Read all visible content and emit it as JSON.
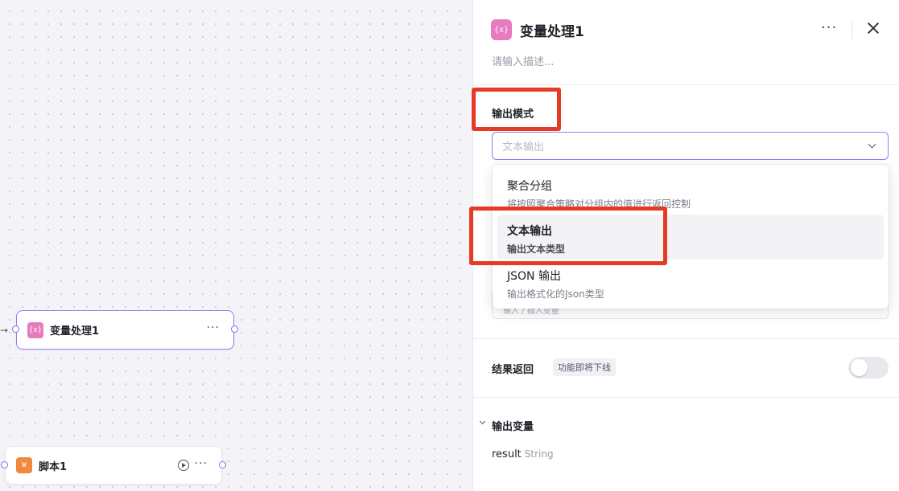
{
  "canvas": {
    "variable_node": {
      "icon_text": "{x}",
      "title": "变量处理1",
      "more": "···"
    },
    "script_node": {
      "icon_text": "W",
      "title": "脚本1",
      "more": "···"
    }
  },
  "panel": {
    "icon_text": "{x}",
    "title": "变量处理1",
    "more": "···",
    "description_placeholder": "请输入描述...",
    "output_mode": {
      "label": "输出模式",
      "select_placeholder": "文本输出",
      "options": [
        {
          "title": "聚合分组",
          "subtitle": "将按照聚合策略对分组内的值进行返回控制"
        },
        {
          "title": "文本输出",
          "subtitle": "输出文本类型",
          "selected": true
        },
        {
          "title": "JSON 输出",
          "subtitle": "输出格式化的Json类型"
        }
      ],
      "behind_input_placeholder": "输入 / 插入变量"
    },
    "result_return": {
      "label": "结果返回",
      "tag": "功能即将下线",
      "enabled": false
    },
    "output_variables": {
      "label": "输出变量",
      "items": [
        {
          "name": "result",
          "type": "String"
        }
      ]
    }
  },
  "colors": {
    "accent": "#8f7ff2",
    "variable_icon": "#e87bbf",
    "script_icon": "#f0883e",
    "highlight": "#e53a25"
  }
}
